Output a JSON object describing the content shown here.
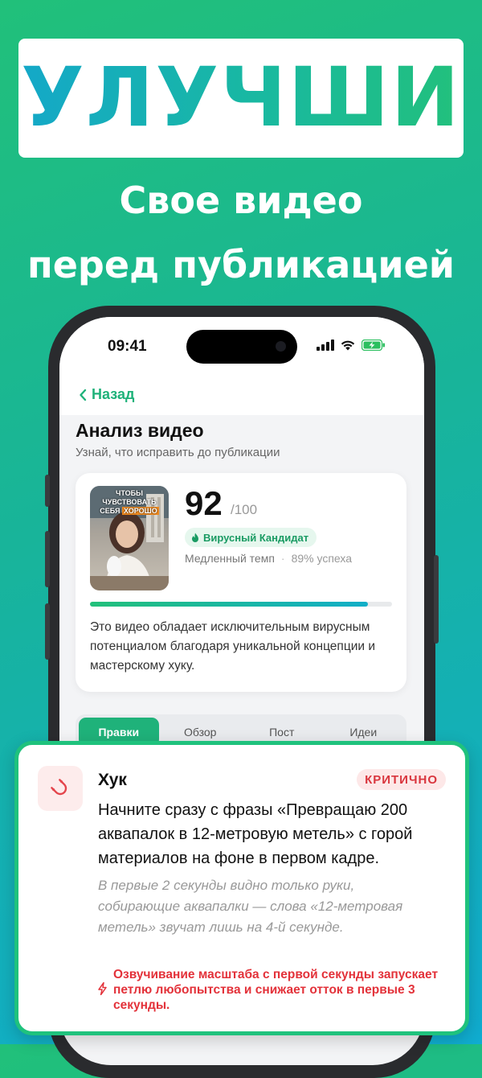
{
  "promo": {
    "headline": "УЛУЧШИ",
    "subline1": "Свое видео",
    "subline2": "перед публикацией"
  },
  "status_bar": {
    "time": "09:41"
  },
  "nav": {
    "back_label": "Назад"
  },
  "page": {
    "title": "Анализ видео",
    "subtitle": "Узнай, что исправить до публикации"
  },
  "analysis": {
    "thumbnail_caption_lines": [
      "ЧТОБЫ",
      "ЧУВСТВОВАТЬ",
      "СЕБЯ"
    ],
    "thumbnail_caption_highlight": "ХОРОШО",
    "score": "92",
    "score_max": "/100",
    "badge": "Вирусный Кандидат",
    "pace": "Медленный темп",
    "separator": "·",
    "success_rate": "89% успеха",
    "progress": 0.92,
    "description": "Это видео обладает исключительным вирусным потенциалом благодаря уникальной концепции и мастерскому хуку."
  },
  "tabs": [
    {
      "label": "Правки",
      "active": true
    },
    {
      "label": "Обзор",
      "active": false
    },
    {
      "label": "Пост",
      "active": false
    },
    {
      "label": "Идеи",
      "active": false
    }
  ],
  "issue_card": {
    "icon": "magnet-icon",
    "title": "Хук",
    "severity": "КРИТИЧНО",
    "suggestion": "Начните сразу с фразы «Превращаю 200 аквапалок в 12-метровую метель» с горой материалов на фоне в первом кадре.",
    "observation": "В первые 2 секунды видно только руки, собирающие аквапалки — слова «12-метровая метель» звучат лишь на 4-й секунде.",
    "impact": "Озвучивание масштаба с первой секунды запускает петлю любопытства и снижает отток в первые 3 секунды."
  },
  "colors": {
    "brand_green": "#1fb27a",
    "brand_cyan": "#12aec8",
    "critical_red": "#e3323a",
    "popup_border": "#1fc27d"
  }
}
